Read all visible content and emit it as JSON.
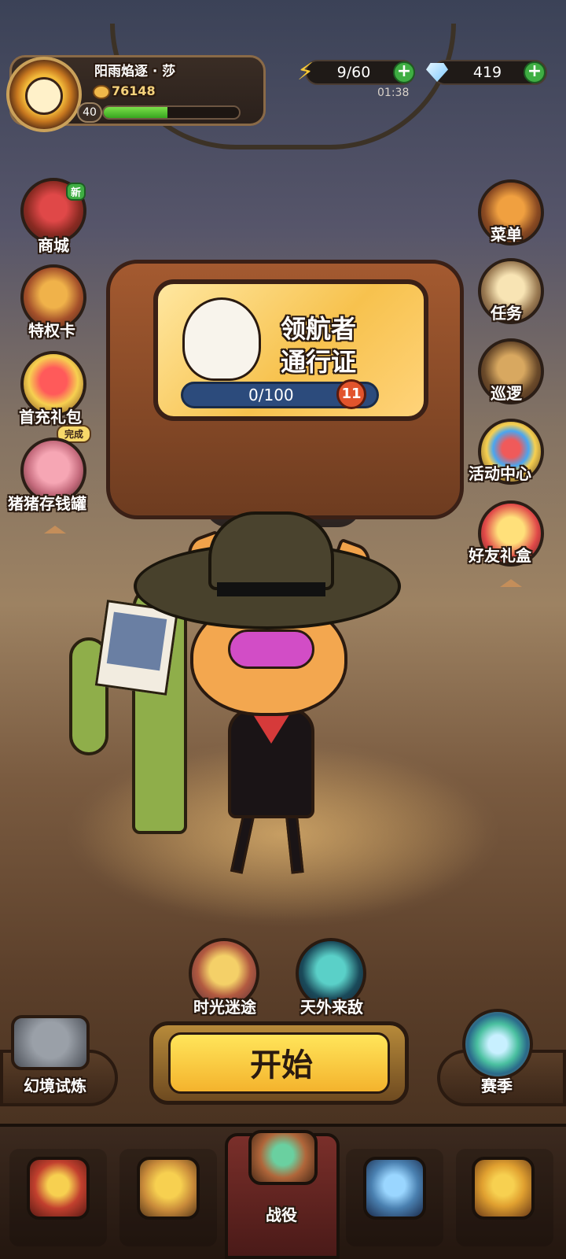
{
  "player": {
    "name": "阳雨焰逐 · 莎",
    "power": "76148",
    "level": "40",
    "xp_fraction": 0.47
  },
  "resources": {
    "energy": "9/60",
    "energy_timer": "01:38",
    "gems": "419",
    "plus": "+"
  },
  "left_menu": [
    {
      "label": "商城",
      "badge": "新",
      "icon": "shop-icon"
    },
    {
      "label": "特权卡",
      "icon": "privilege-card-icon"
    },
    {
      "label": "首充礼包",
      "icon": "gift-box-icon"
    },
    {
      "label": "猪猪存钱罐",
      "badge": "完成",
      "icon": "piggy-bank-icon"
    }
  ],
  "right_menu": [
    {
      "label": "菜单",
      "icon": "menu-icon"
    },
    {
      "label": "任务",
      "icon": "quest-scroll-icon"
    },
    {
      "label": "巡逻",
      "icon": "telescope-icon"
    },
    {
      "label": "活动中心",
      "icon": "balloons-icon"
    },
    {
      "label": "好友礼盒",
      "icon": "friend-gift-icon"
    }
  ],
  "pass": {
    "title_line1": "领航者",
    "title_line2": "通行证",
    "progress": "0/100",
    "level": "11"
  },
  "modes": {
    "time_maze": "时光迷途",
    "alien_enemy": "天外来敌",
    "illusion_trial": "幻境试炼",
    "season": "赛季",
    "start": "开始"
  },
  "bottom_nav": {
    "active_label": "战役",
    "items": [
      "hero-chest-icon",
      "treasure-cart-icon",
      "campaign-icon",
      "goggles-helmet-icon",
      "card-book-icon"
    ]
  },
  "colors": {
    "accent_green": "#3fae43",
    "start_yellow": "#ffe55a",
    "pass_level_red": "#e2542c"
  }
}
